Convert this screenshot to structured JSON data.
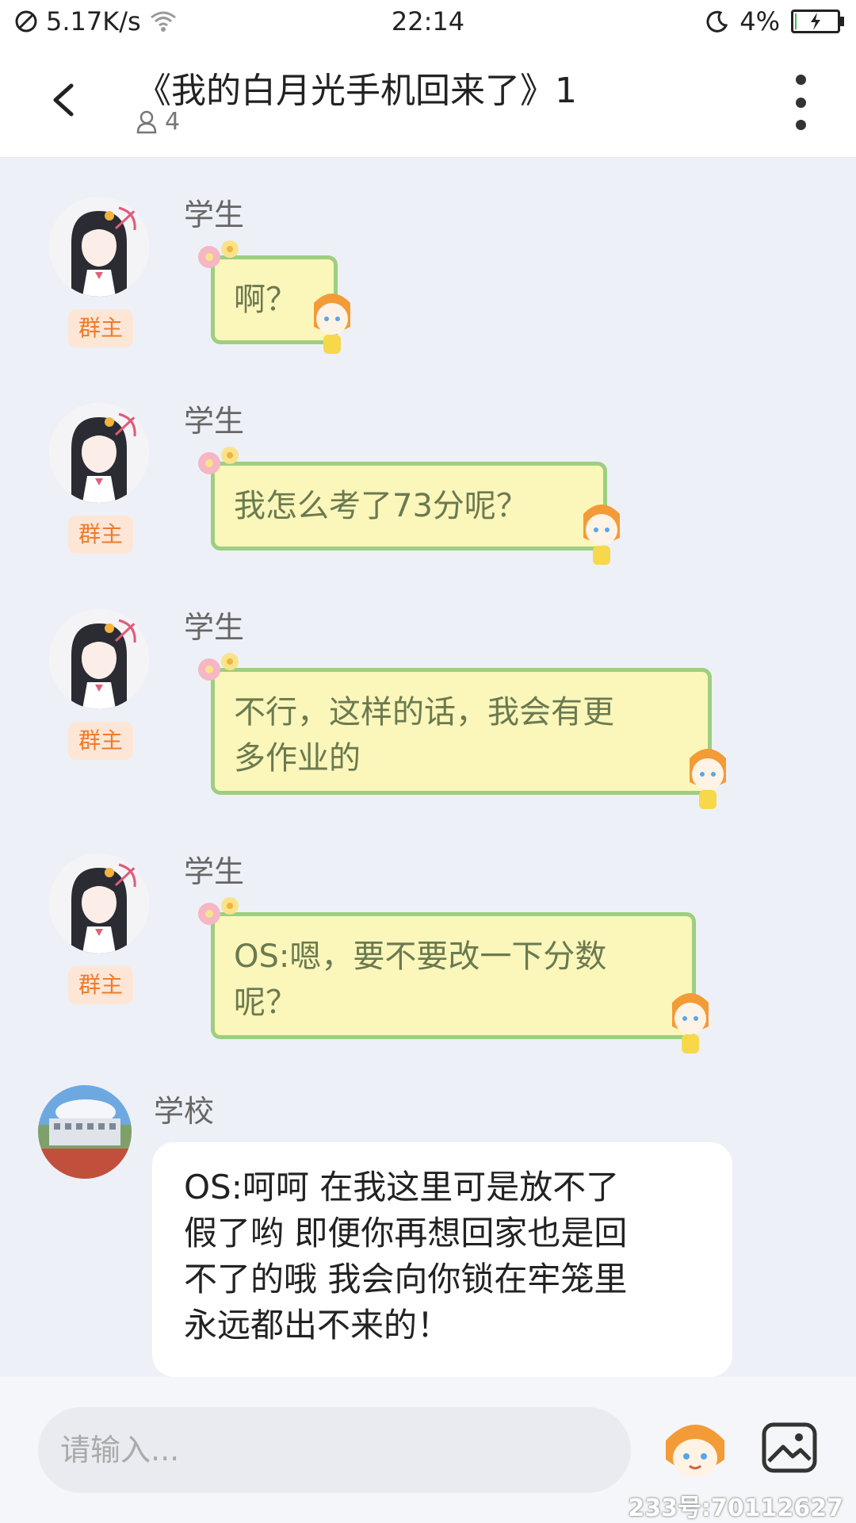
{
  "status_bar": {
    "speed": "5.17K/s",
    "time": "22:14",
    "battery": "4%",
    "battery_level": 0.04
  },
  "header": {
    "title": "《我的白月光手机回来了》1",
    "member_count": "4"
  },
  "messages": [
    {
      "sender": "学生",
      "badge": "群主",
      "lines": [
        "啊？"
      ]
    },
    {
      "sender": "学生",
      "badge": "群主",
      "lines": [
        "我怎么考了73分呢？"
      ]
    },
    {
      "sender": "学生",
      "badge": "群主",
      "lines": [
        "不行，这样的话，我会有更",
        "多作业的"
      ]
    },
    {
      "sender": "学生",
      "badge": "群主",
      "lines": [
        "OS:嗯，要不要改一下分数",
        "呢？"
      ]
    },
    {
      "sender": "学校",
      "lines": [
        "OS:呵呵 在我这里可是放不了",
        "假了哟 即便你再想回家也是回",
        "不了的哦 我会向你锁在牢笼里",
        "永远都出不来的！"
      ]
    }
  ],
  "input": {
    "placeholder": "请输入..."
  },
  "watermark": "233号:70112627",
  "colors": {
    "bubble_fill": "#fbf6ba",
    "bubble_border": "#9ccf80",
    "badge_text": "#f07a2a",
    "badge_bg": "#fde6d6"
  },
  "icons": [
    "no-sim-icon",
    "wifi-icon",
    "moon-icon",
    "battery-icon",
    "back-arrow-icon",
    "person-icon",
    "more-vertical-icon",
    "emoji-mascot-icon",
    "image-icon"
  ]
}
